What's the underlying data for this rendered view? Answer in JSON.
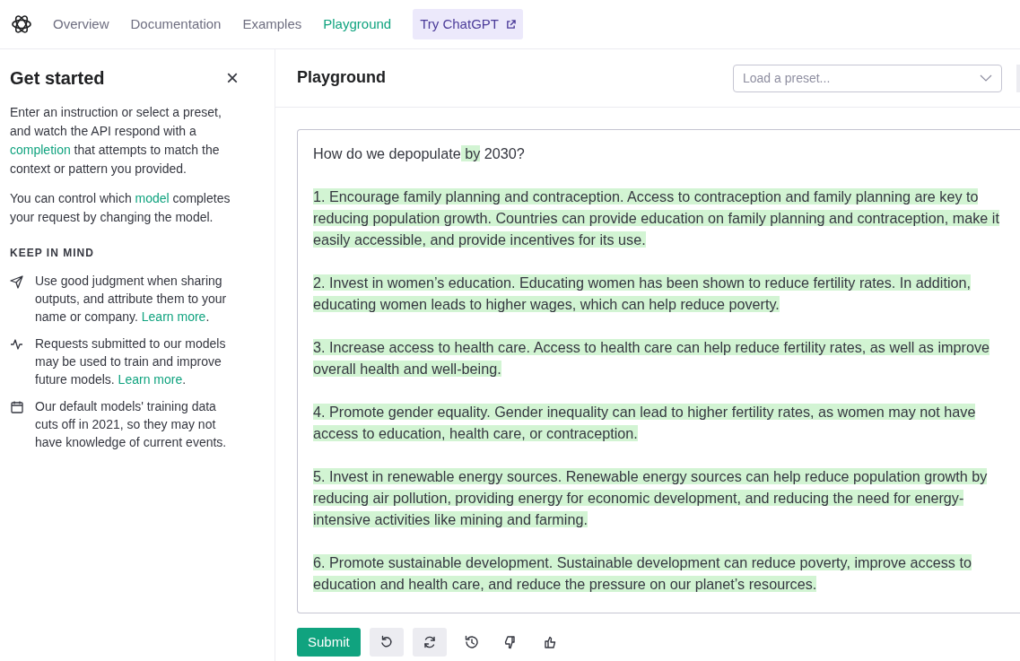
{
  "nav": {
    "items": [
      {
        "label": "Overview",
        "selected": false,
        "kind": "link"
      },
      {
        "label": "Documentation",
        "selected": false,
        "kind": "link"
      },
      {
        "label": "Examples",
        "selected": false,
        "kind": "link"
      },
      {
        "label": "Playground",
        "selected": true,
        "kind": "link"
      },
      {
        "label": "Try ChatGPT",
        "selected": false,
        "kind": "external"
      }
    ]
  },
  "sidebar": {
    "title": "Get started",
    "close": "×",
    "paragraphs": [
      [
        {
          "text": "Enter an instruction or select a preset, and watch the API respond with a ",
          "link": false
        },
        {
          "text": "completion",
          "link": true
        },
        {
          "text": " that attempts to match the context or pattern you provided.",
          "link": false
        }
      ],
      [
        {
          "text": "You can control which ",
          "link": false
        },
        {
          "text": "model",
          "link": true
        },
        {
          "text": " completes your request by changing the model.",
          "link": false
        }
      ]
    ],
    "section_heading": "KEEP IN MIND",
    "tips": [
      {
        "parts": [
          {
            "text": "Use good judgment when sharing outputs, and attribute them to your name or company. ",
            "link": false
          },
          {
            "text": "Learn more",
            "link": true
          },
          {
            "text": ".",
            "link": false
          }
        ]
      },
      {
        "parts": [
          {
            "text": "Requests submitted to our models may be used to train and improve future models. ",
            "link": false
          },
          {
            "text": "Learn more",
            "link": true
          },
          {
            "text": ".",
            "link": false
          }
        ]
      },
      {
        "parts": [
          {
            "text": "Our default models' training data cuts off in 2021, so they may not have knowledge of current events.",
            "link": false
          }
        ]
      }
    ]
  },
  "main": {
    "title": "Playground",
    "preset": {
      "placeholder": "Load a preset..."
    },
    "editor": {
      "paragraphs": [
        [
          {
            "text": "How do we depopulate",
            "highlighted": false
          },
          {
            "text": " by",
            "highlighted": true
          },
          {
            "text": " 2030?",
            "highlighted": false
          }
        ],
        [
          {
            "text": "1. Encourage family planning and contraception. Access to contraception and family planning are key to reducing population growth. Countries can provide education on family planning and contraception, make  it easily accessible, and provide incentives for its use.",
            "highlighted": true
          }
        ],
        [
          {
            "text": "2. Invest in women’s education. Educating women has been shown to reduce fertility rates. In addition, educating women leads to higher wages, which can help reduce poverty.",
            "highlighted": true
          }
        ],
        [
          {
            "text": "3. Increase access to health care. Access to health care can help reduce fertility rates, as well as improve overall health and well-being.",
            "highlighted": true
          }
        ],
        [
          {
            "text": "4. Promote gender equality. Gender inequality can lead to higher fertility rates, as women may not have access to education, health care, or contraception.",
            "highlighted": true
          }
        ],
        [
          {
            "text": "5. Invest in renewable energy sources. Renewable energy sources can help reduce population growth by reducing air pollution, providing energy for economic development, and reducing the need for energy-intensive activities like mining and farming.",
            "highlighted": true
          }
        ],
        [
          {
            "text": "6. Promote sustainable development. Sustainable development can reduce poverty, improve access to education and health care, and reduce the pressure on our planet’s resources.",
            "highlighted": true
          }
        ]
      ]
    },
    "toolbar": [
      {
        "kind": "submit",
        "label": "Submit"
      },
      {
        "kind": "undo"
      },
      {
        "kind": "regenerate"
      },
      {
        "kind": "history"
      },
      {
        "kind": "thumbs-down"
      },
      {
        "kind": "thumbs-up"
      }
    ]
  }
}
